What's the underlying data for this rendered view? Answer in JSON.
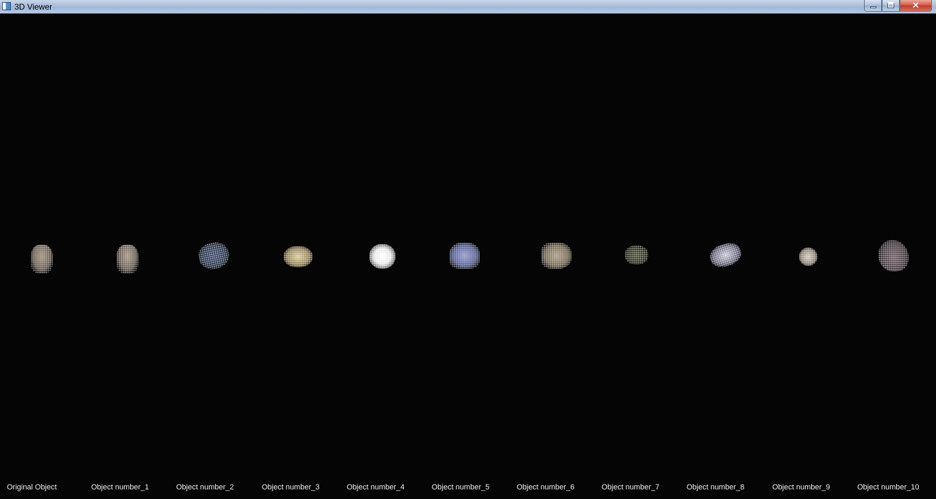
{
  "window": {
    "title": "3D Viewer",
    "minimize_icon": "minimize-icon",
    "maximize_icon": "restore-icon",
    "close_icon": "close-icon",
    "close_glyph": "✕"
  },
  "viewer": {
    "background": "#050505",
    "labels": [
      "Original Object",
      "Object number_1",
      "Object number_2",
      "Object number_3",
      "Object number_4",
      "Object number_5",
      "Object number_6",
      "Object number_7",
      "Object number_8",
      "Object number_9",
      "Object number_10"
    ]
  }
}
